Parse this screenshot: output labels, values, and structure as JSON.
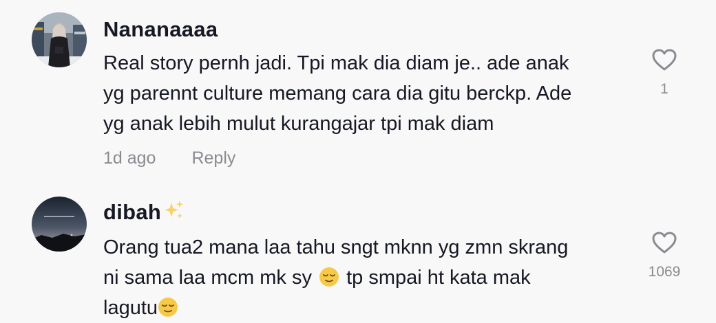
{
  "comments": [
    {
      "username": "Nananaaaa",
      "lines": [
        "Real story pernh jadi. Tpi mak dia diam je.. ade anak",
        "yg parennt culture memang cara dia gitu berckp. Ade",
        "yg anak lebih mulut kurangajar tpi mak diam"
      ],
      "time": "1d ago",
      "reply_label": "Reply",
      "likes": "1",
      "icons": {
        "avatar": "avatar-photo",
        "like": "heart-outline-icon"
      }
    },
    {
      "username": "dibah",
      "username_suffix_icon": "sparkles-icon",
      "line1": "Orang tua2 mana laa tahu sngt mknn yg zmn skrang",
      "line2_before": "ni sama laa mcm mk sy",
      "line2_emoji": "relieved-face-emoji",
      "line2_after": "tp smpai ht kata mak",
      "line3": "lagutu",
      "line3_emoji": "relieved-face-emoji",
      "likes": "1069",
      "icons": {
        "avatar": "avatar-photo",
        "like": "heart-outline-icon"
      }
    }
  ],
  "colors": {
    "background": "#f8f8f8",
    "primary_text": "#161823",
    "secondary_text": "#8a8b91",
    "icon": "#8a8b91"
  }
}
